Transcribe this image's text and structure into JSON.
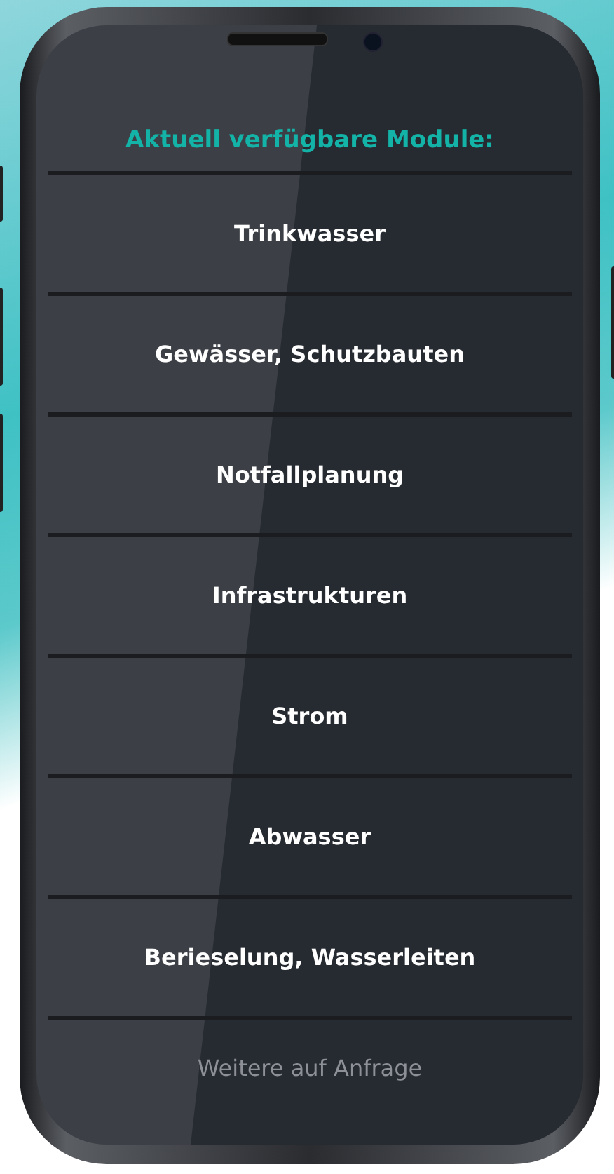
{
  "title": "Aktuell verfügbare Module:",
  "modules": [
    {
      "label": "Trinkwasser"
    },
    {
      "label": "Gewässer, Schutzbauten"
    },
    {
      "label": "Notfallplanung"
    },
    {
      "label": "Infrastrukturen"
    },
    {
      "label": "Strom"
    },
    {
      "label": "Abwasser"
    },
    {
      "label": "Berieselung, Wasserleiten"
    }
  ],
  "footer": "Weitere auf Anfrage"
}
